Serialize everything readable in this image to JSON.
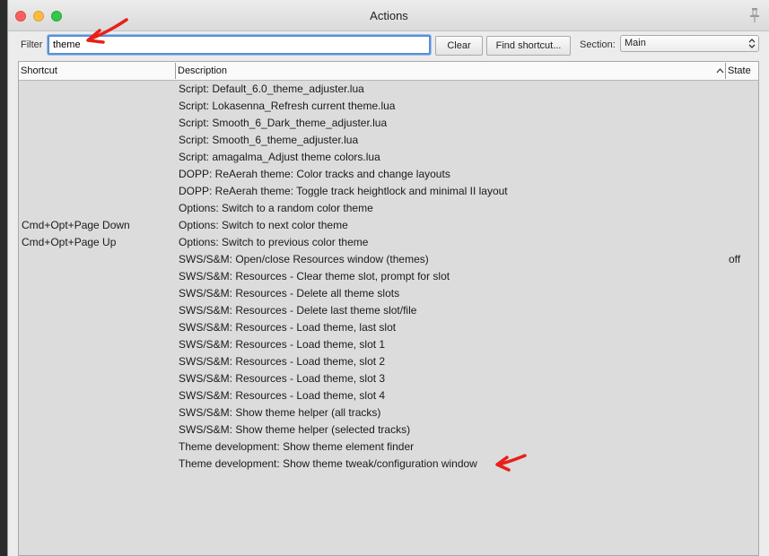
{
  "window": {
    "title": "Actions"
  },
  "filter": {
    "label": "Filter",
    "value": "theme"
  },
  "buttons": {
    "clear": "Clear",
    "find_shortcut": "Find shortcut..."
  },
  "section": {
    "label": "Section:",
    "selected": "Main"
  },
  "columns": {
    "shortcut": "Shortcut",
    "description": "Description",
    "state": "State"
  },
  "rows": [
    {
      "shortcut": "",
      "description": "Script: Default_6.0_theme_adjuster.lua",
      "state": ""
    },
    {
      "shortcut": "",
      "description": "Script: Lokasenna_Refresh current theme.lua",
      "state": ""
    },
    {
      "shortcut": "",
      "description": "Script: Smooth_6_Dark_theme_adjuster.lua",
      "state": ""
    },
    {
      "shortcut": "",
      "description": "Script: Smooth_6_theme_adjuster.lua",
      "state": ""
    },
    {
      "shortcut": "",
      "description": "Script: amagalma_Adjust theme colors.lua",
      "state": ""
    },
    {
      "shortcut": "",
      "description": "DOPP: ReAerah theme: Color tracks and change layouts",
      "state": ""
    },
    {
      "shortcut": "",
      "description": "DOPP: ReAerah theme: Toggle track heightlock and minimal II layout",
      "state": ""
    },
    {
      "shortcut": "",
      "description": "Options: Switch to a random color theme",
      "state": ""
    },
    {
      "shortcut": "Cmd+Opt+Page Down",
      "description": "Options: Switch to next color theme",
      "state": ""
    },
    {
      "shortcut": "Cmd+Opt+Page Up",
      "description": "Options: Switch to previous color theme",
      "state": ""
    },
    {
      "shortcut": "",
      "description": "SWS/S&M: Open/close Resources window (themes)",
      "state": "off"
    },
    {
      "shortcut": "",
      "description": "SWS/S&M: Resources - Clear theme slot, prompt for slot",
      "state": ""
    },
    {
      "shortcut": "",
      "description": "SWS/S&M: Resources - Delete all theme slots",
      "state": ""
    },
    {
      "shortcut": "",
      "description": "SWS/S&M: Resources - Delete last theme slot/file",
      "state": ""
    },
    {
      "shortcut": "",
      "description": "SWS/S&M: Resources - Load theme, last slot",
      "state": ""
    },
    {
      "shortcut": "",
      "description": "SWS/S&M: Resources - Load theme, slot 1",
      "state": ""
    },
    {
      "shortcut": "",
      "description": "SWS/S&M: Resources - Load theme, slot 2",
      "state": ""
    },
    {
      "shortcut": "",
      "description": "SWS/S&M: Resources - Load theme, slot 3",
      "state": ""
    },
    {
      "shortcut": "",
      "description": "SWS/S&M: Resources - Load theme, slot 4",
      "state": ""
    },
    {
      "shortcut": "",
      "description": "SWS/S&M: Show theme helper (all tracks)",
      "state": ""
    },
    {
      "shortcut": "",
      "description": "SWS/S&M: Show theme helper (selected tracks)",
      "state": ""
    },
    {
      "shortcut": "",
      "description": "Theme development: Show theme element finder",
      "state": ""
    },
    {
      "shortcut": "",
      "description": "Theme development: Show theme tweak/configuration window",
      "state": ""
    }
  ],
  "icons": {
    "pin": "pin-icon",
    "sort": "sort-ascending-icon",
    "select": "updown-chevron-icon",
    "annotation": "red-arrow-annotation"
  },
  "colors": {
    "focus_ring": "#5a8fd6",
    "annotation": "#e8201a",
    "list_bg": "#dcdcdc"
  }
}
